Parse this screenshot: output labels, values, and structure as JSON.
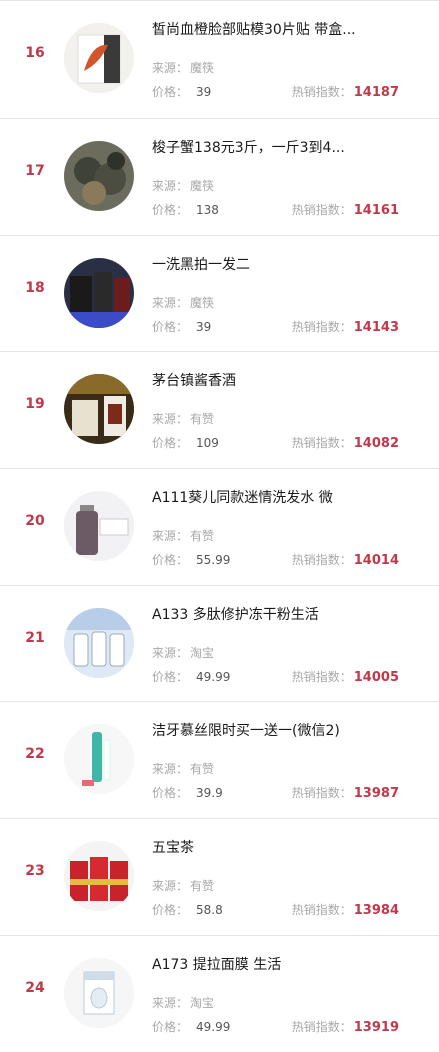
{
  "labels": {
    "source": "来源：",
    "price": "价格：",
    "hot": "热销指数："
  },
  "items": [
    {
      "rank": "16",
      "title": "皙尚血橙脸部贴模30片贴 带盒...",
      "source": "魔筷",
      "price": "39",
      "hot": "14187",
      "thumb": "mask-box"
    },
    {
      "rank": "17",
      "title": "梭子蟹138元3斤，一斤3到4...",
      "source": "魔筷",
      "price": "138",
      "hot": "14161",
      "thumb": "crabs"
    },
    {
      "rank": "18",
      "title": "一洗黑拍一发二",
      "source": "魔筷",
      "price": "39",
      "hot": "14143",
      "thumb": "hair-dye"
    },
    {
      "rank": "19",
      "title": "茅台镇酱香酒",
      "source": "有赞",
      "price": "109",
      "hot": "14082",
      "thumb": "liquor"
    },
    {
      "rank": "20",
      "title": "A111葵儿同款迷情洗发水 微",
      "source": "有赞",
      "price": "55.99",
      "hot": "14014",
      "thumb": "shampoo"
    },
    {
      "rank": "21",
      "title": "A133 多肽修护冻干粉生活",
      "source": "淘宝",
      "price": "49.99",
      "hot": "14005",
      "thumb": "serum"
    },
    {
      "rank": "22",
      "title": "洁牙慕丝限时买一送一(微信2)",
      "source": "有赞",
      "price": "39.9",
      "hot": "13987",
      "thumb": "toothpaste"
    },
    {
      "rank": "23",
      "title": "五宝茶",
      "source": "有赞",
      "price": "58.8",
      "hot": "13984",
      "thumb": "tea"
    },
    {
      "rank": "24",
      "title": "A173 提拉面膜 生活",
      "source": "淘宝",
      "price": "49.99",
      "hot": "13919",
      "thumb": "face-mask"
    }
  ]
}
